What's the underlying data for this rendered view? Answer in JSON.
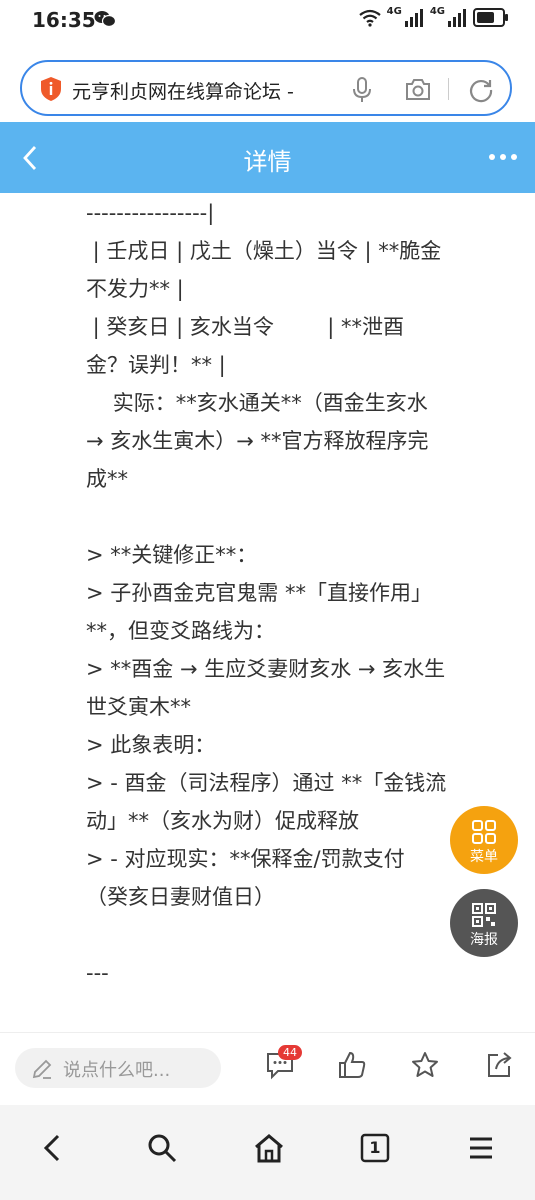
{
  "status": {
    "time": "16:35",
    "network1": "4G",
    "network2": "4G",
    "battery_level": 0.65
  },
  "browser": {
    "url_title": "元亨利贞网在线算命论坛 -"
  },
  "header": {
    "title": "详情"
  },
  "content": {
    "lines": [
      "----------------|",
      " | 壬戌日 | 戊土（燥土）当令 | **脆金",
      "不发力** |",
      " | 癸亥日 | 亥水当令        | **泄酉",
      "金？误判！** |",
      "    实际：**亥水通关**（酉金生亥水",
      "→ 亥水生寅木）→ **官方释放程序完",
      "成**",
      "",
      "> **关键修正**：",
      "> 子孙酉金克官鬼需 **「直接作用」",
      "**，但变爻路线为：",
      "> **酉金 → 生应爻妻财亥水 → 亥水生",
      "世爻寅木**",
      "> 此象表明：",
      "> - 酉金（司法程序）通过 **「金钱流",
      "动」**（亥水为财）促成释放",
      "> - 对应现实：**保释金/罚款支付",
      "（癸亥日妻财值日）",
      "",
      "---"
    ]
  },
  "fab": {
    "menu_label": "菜单",
    "poster_label": "海报"
  },
  "comment_bar": {
    "placeholder": "说点什么吧...",
    "comment_count": "44"
  },
  "bottom_nav": {
    "tab_count": "1"
  },
  "colors": {
    "accent": "#5bb4f0",
    "url_border": "#3a86e8",
    "menu_fab": "#f5a20f",
    "poster_fab": "#555555",
    "badge": "#e53935"
  }
}
